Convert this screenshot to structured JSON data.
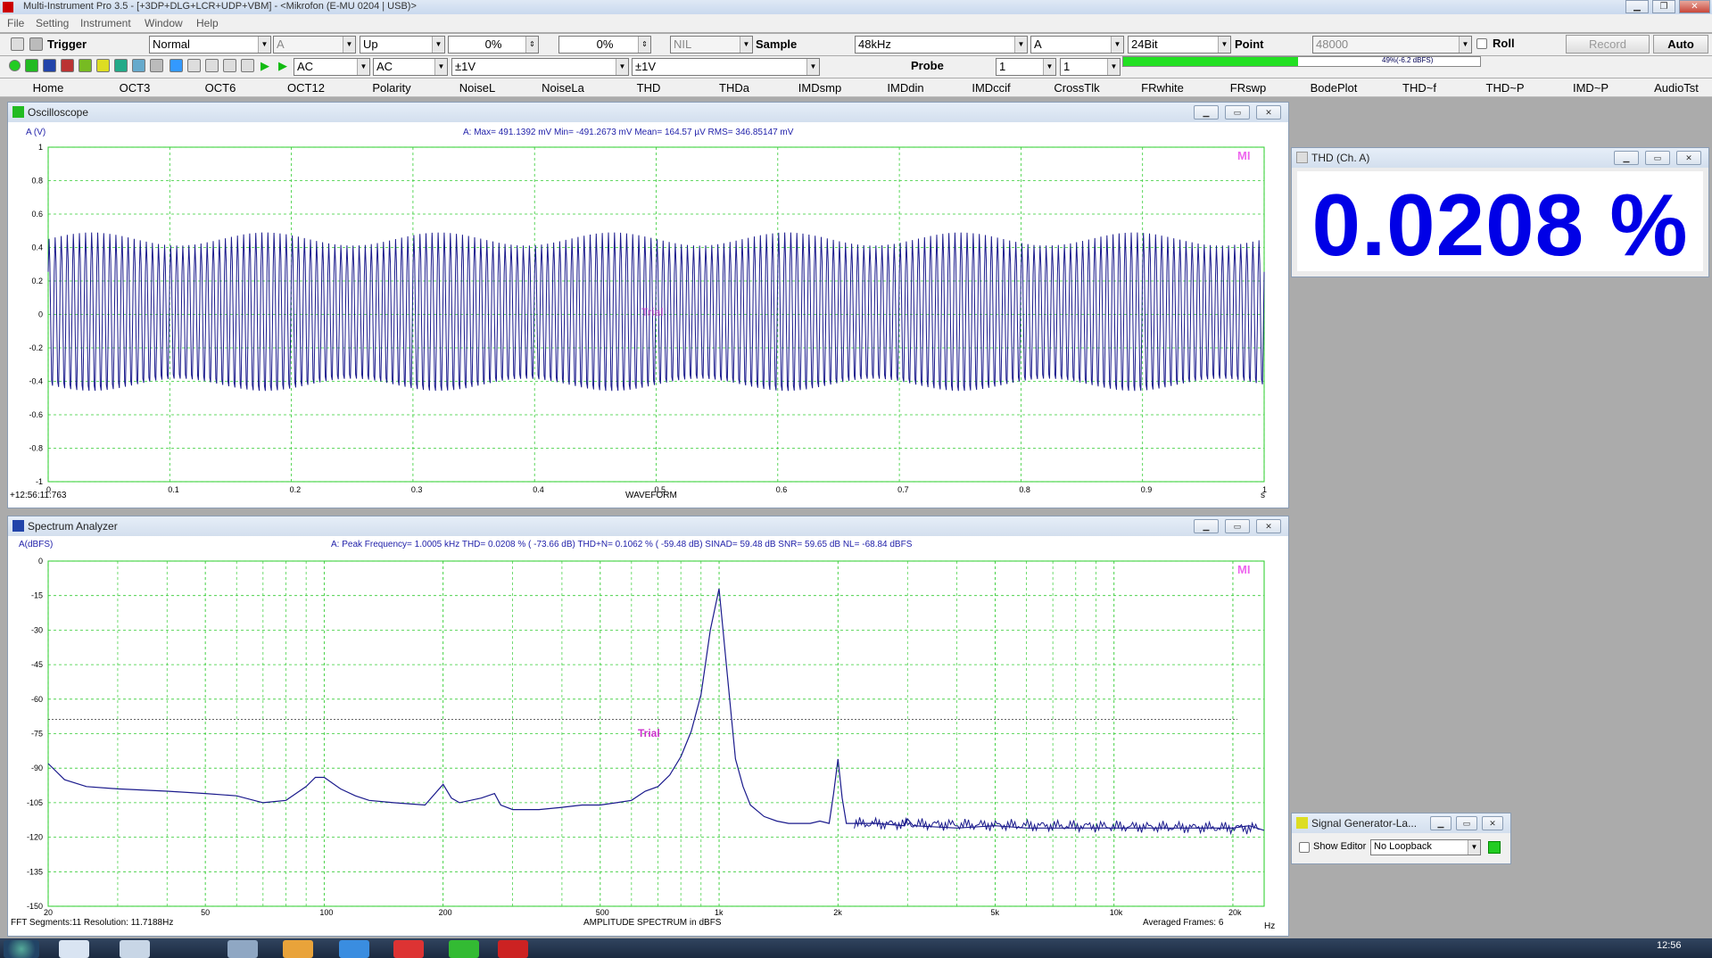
{
  "window": {
    "title": "Multi-Instrument Pro 3.5   -   [+3DP+DLG+LCR+UDP+VBM]   -   <Mikrofon (E-MU 0204 | USB)>"
  },
  "menu": [
    "File",
    "Setting",
    "Instrument",
    "Window",
    "Help"
  ],
  "toolbar1": {
    "trigger_label": "Trigger",
    "trigger_mode": "Normal",
    "trigger_channel": "A",
    "trigger_edge": "Up",
    "trigger_level": "0%",
    "trigger_pre": "0%",
    "nil": "NIL",
    "sample_label": "Sample",
    "sample_rate": "48kHz",
    "sample_channel": "A",
    "bit_depth": "24Bit",
    "point_label": "Point",
    "points": "48000",
    "roll_label": "Roll",
    "record_label": "Record",
    "auto_label": "Auto"
  },
  "toolbar2": {
    "coupling_a": "AC",
    "coupling_b": "AC",
    "range_a": "±1V",
    "range_b": "±1V",
    "probe_label": "Probe",
    "probe_a": "1",
    "probe_b": "1",
    "level_value": 0.49,
    "level_text": "49%(-6.2 dBFS)"
  },
  "nav": [
    "Home",
    "OCT3",
    "OCT6",
    "OCT12",
    "Polarity",
    "NoiseL",
    "NoiseLa",
    "THD",
    "THDa",
    "IMDsmp",
    "IMDdin",
    "IMDccif",
    "CrossTlk",
    "FRwhite",
    "FRswp",
    "BodePlot",
    "THD~f",
    "THD~P",
    "IMD~P",
    "AudioTst"
  ],
  "oscilloscope": {
    "title": "Oscilloscope",
    "ylabel": "A (V)",
    "stats": "A: Max=      491.1392  mV  Min=     -491.2673  mV  Mean=          164.57   µV  RMS=      346.85147  mV",
    "watermark": "Trial",
    "corner": "MI",
    "timestamp": "+12:56:11:763",
    "xlabel": "WAVEFORM",
    "xunit": "s",
    "chart_data": {
      "type": "line",
      "title": "",
      "xlabel": "WAVEFORM",
      "ylabel": "A (V)",
      "xlim": [
        0,
        1
      ],
      "ylim": [
        -1,
        1
      ],
      "x_ticks": [
        "0",
        "0.1",
        "0.2",
        "0.3",
        "0.4",
        "0.5",
        "0.6",
        "0.7",
        "0.8",
        "0.9",
        "1"
      ],
      "y_ticks": [
        "1",
        "0.8",
        "0.6",
        "0.4",
        "0.2",
        "0",
        "-0.2",
        "-0.4",
        "-0.6",
        "-0.8",
        "-1"
      ],
      "max": 0.4911392,
      "min": -0.4912673,
      "mean": 0.00016457,
      "rms": 0.34685147,
      "grid": true
    }
  },
  "spectrum": {
    "title": "Spectrum Analyzer",
    "ylabel": "A(dBFS)",
    "stats": "A: Peak Frequency=       1.0005   kHz  THD=       0.0208 % (   -73.66 dB)  THD+N=      0.1062 % (    -59.48 dB)   SINAD=       59.48 dB   SNR=       59.65 dB   NL=     -68.84 dBFS",
    "watermark": "Trial",
    "corner": "MI",
    "footer_left": "FFT Segments:11      Resolution: 11.7188Hz",
    "xlabel": "AMPLITUDE SPECTRUM in dBFS",
    "footer_right": "Averaged Frames: 6",
    "xunit": "Hz",
    "chart_data": {
      "type": "line",
      "title": "",
      "xlabel": "AMPLITUDE SPECTRUM in dBFS",
      "ylabel": "A(dBFS)",
      "xscale": "log",
      "xlim": [
        20,
        24000
      ],
      "ylim": [
        -150,
        0
      ],
      "x_ticks": [
        "20",
        "50",
        "100",
        "200",
        "500",
        "1k",
        "2k",
        "5k",
        "10k",
        "20k"
      ],
      "y_ticks": [
        "0",
        "-15",
        "-30",
        "-45",
        "-60",
        "-75",
        "-90",
        "-105",
        "-120",
        "-135",
        "-150"
      ],
      "noise_level_line": -68.84,
      "grid": true,
      "series": [
        {
          "x": [
            20,
            22,
            25,
            30,
            40,
            50,
            60,
            70,
            80,
            90,
            95,
            100,
            110,
            120,
            130,
            150,
            180,
            200,
            210,
            220,
            250,
            270,
            280,
            300,
            350,
            400,
            450,
            500,
            550,
            600,
            650,
            700,
            750,
            800,
            850,
            900,
            950,
            1000,
            1050,
            1100,
            1150,
            1200,
            1300,
            1400,
            1500,
            1600,
            1700,
            1800,
            1900,
            1950,
            2000,
            2050,
            2100,
            2500,
            2950,
            3000,
            3100,
            4000,
            5000,
            6000,
            8000,
            10000,
            12000,
            15000,
            18000,
            20000,
            22000,
            24000
          ],
          "y": [
            -88,
            -95,
            -98,
            -99,
            -100,
            -101,
            -102,
            -105,
            -104,
            -98,
            -94,
            -94,
            -99,
            -102,
            -104,
            -105,
            -106,
            -97,
            -103,
            -105,
            -103,
            -101,
            -106,
            -108,
            -108,
            -107,
            -106,
            -106,
            -105,
            -104,
            -100,
            -98,
            -93,
            -85,
            -74,
            -58,
            -30,
            -12,
            -50,
            -86,
            -98,
            -106,
            -111,
            -113,
            -114,
            -114,
            -114,
            -113,
            -114,
            -101,
            -86,
            -103,
            -114,
            -114,
            -115,
            -112,
            -115,
            -116,
            -115,
            -116,
            -116,
            -116,
            -116,
            -116,
            -116,
            -116,
            -115,
            -117
          ]
        }
      ]
    }
  },
  "thd_panel": {
    "title": "THD (Ch. A)",
    "value": "0.0208 %"
  },
  "siggen": {
    "title": "Signal Generator-La...",
    "show_editor_label": "Show Editor",
    "loopback": "No Loopback"
  },
  "taskbar": {
    "clock": "12:56"
  }
}
